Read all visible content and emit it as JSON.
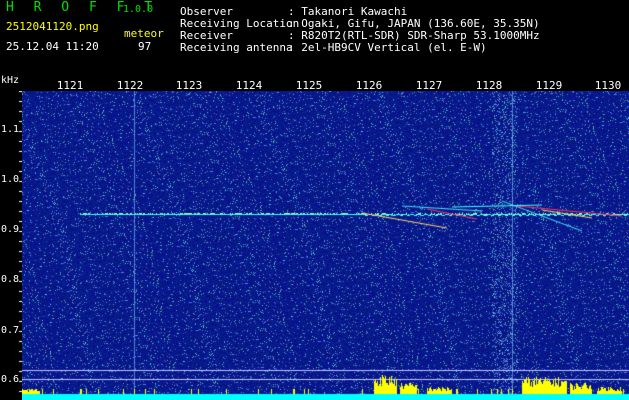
{
  "header": {
    "app_name": "H R O F F T",
    "version": "1.0.0",
    "filename": "2512041120.png",
    "timestamp": "25.12.04 11:20",
    "mode_label": "meteor",
    "count": "97",
    "info_labels": [
      "Observer",
      "Receiving Location",
      "Receiver",
      "Receiving antenna"
    ],
    "info_values": [
      ": Takanori Kawachi",
      ": Ogaki, Gifu, JAPAN (136.60E, 35.35N)",
      ": R820T2(RTL-SDR) SDR-Sharp 53.1000MHz",
      ": 2el-HB9CV Vertical (el. E-W)"
    ]
  },
  "plot": {
    "x_ticks": [
      "1121",
      "1122",
      "1123",
      "1124",
      "1125",
      "1126",
      "1127",
      "1128",
      "1129",
      "1130"
    ],
    "y_unit": "kHz",
    "y_ticks": [
      "1.1",
      "1.0",
      "0.9",
      "0.8",
      "0.7",
      "0.6"
    ],
    "colors": {
      "background": "#0a0a88",
      "carrier": "#40ffff",
      "echo": "#ff3060",
      "histogram": "#ffff00",
      "floor": "#00ffff"
    }
  }
}
